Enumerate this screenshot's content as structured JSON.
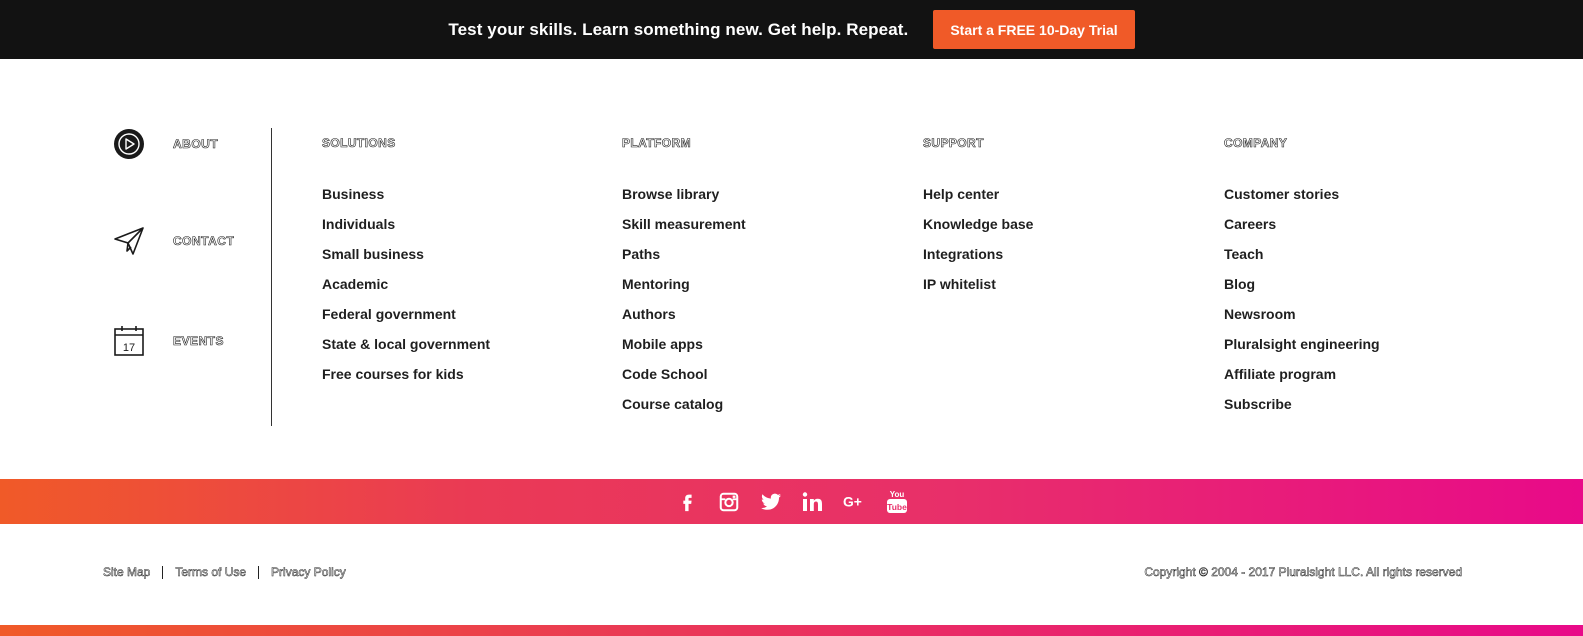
{
  "banner": {
    "text": "Test your skills. Learn something new. Get help. Repeat.",
    "cta_label": "Start a FREE 10-Day Trial",
    "cta_color": "#f05a28",
    "background": "#121212"
  },
  "left_nav": {
    "items": [
      {
        "label": "ABOUT",
        "icon": "play-circle-icon"
      },
      {
        "label": "CONTACT",
        "icon": "paper-plane-icon"
      },
      {
        "label": "EVENTS",
        "icon": "calendar-icon",
        "icon_text": "17"
      }
    ]
  },
  "columns": [
    {
      "heading": "SOLUTIONS",
      "links": [
        "Business",
        "Individuals",
        "Small business",
        "Academic",
        "Federal government",
        "State & local government",
        "Free courses for kids"
      ]
    },
    {
      "heading": "PLATFORM",
      "links": [
        "Browse library",
        "Skill measurement",
        "Paths",
        "Mentoring",
        "Authors",
        "Mobile apps",
        "Code School",
        "Course catalog"
      ]
    },
    {
      "heading": "SUPPORT",
      "links": [
        "Help center",
        "Knowledge base",
        "Integrations",
        "IP whitelist"
      ]
    },
    {
      "heading": "COMPANY",
      "links": [
        "Customer stories",
        "Careers",
        "Teach",
        "Blog",
        "Newsroom",
        "Pluralsight engineering",
        "Affiliate program",
        "Subscribe"
      ]
    }
  ],
  "social": {
    "icons": [
      "facebook-icon",
      "instagram-icon",
      "twitter-icon",
      "linkedin-icon",
      "google-plus-icon",
      "youtube-icon"
    ],
    "gradient": [
      "#f05a28",
      "#e80a89"
    ]
  },
  "bottom": {
    "links": [
      "Site Map",
      "Terms of Use",
      "Privacy Policy"
    ],
    "copyright": "Copyright © 2004 - 2017 Pluralsight LLC. All rights reserved"
  }
}
